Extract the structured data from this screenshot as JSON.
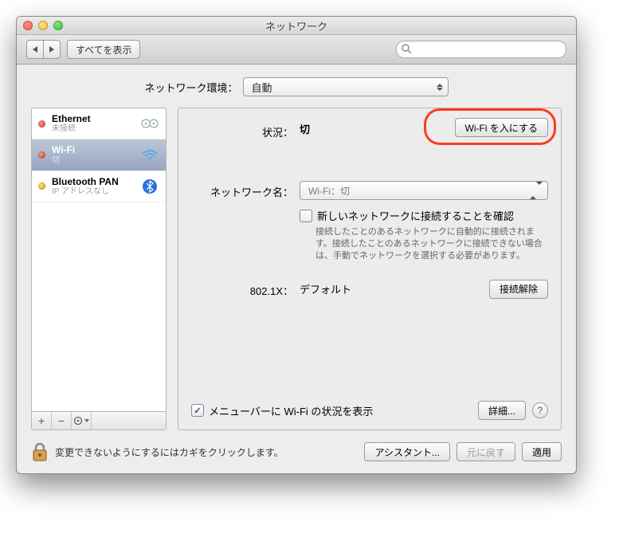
{
  "window": {
    "title": "ネットワーク"
  },
  "toolbar": {
    "show_all": "すべてを表示",
    "search_placeholder": "Q"
  },
  "location": {
    "label": "ネットワーク環境：",
    "value": "自動"
  },
  "sidebar": {
    "items": [
      {
        "name": "Ethernet",
        "sub": "未接続",
        "status": "red",
        "icon": "ethernet",
        "selected": false
      },
      {
        "name": "Wi-Fi",
        "sub": "切",
        "status": "red",
        "icon": "wifi",
        "selected": true
      },
      {
        "name": "Bluetooth PAN",
        "sub": "IP アドレスなし",
        "status": "yellow",
        "icon": "bluetooth",
        "selected": false
      }
    ]
  },
  "panel": {
    "status": {
      "label": "状況：",
      "value": "切",
      "button": "Wi-Fi を入にする"
    },
    "network_name": {
      "label": "ネットワーク名：",
      "value": "Wi-Fi：切"
    },
    "confirm_new": {
      "label": "新しいネットワークに接続することを確認",
      "desc": "接続したことのあるネットワークに自動的に接続されます。接続したことのあるネットワークに接続できない場合は、手動でネットワークを選択する必要があります。"
    },
    "dot1x": {
      "label": "802.1X：",
      "value": "デフォルト",
      "button": "接続解除"
    },
    "menubar": {
      "label": "メニューバーに Wi-Fi の状況を表示"
    },
    "advanced": "詳細..."
  },
  "bottom": {
    "lock_text": "変更できないようにするにはカギをクリックします。",
    "assistant": "アシスタント...",
    "revert": "元に戻す",
    "apply": "適用"
  }
}
